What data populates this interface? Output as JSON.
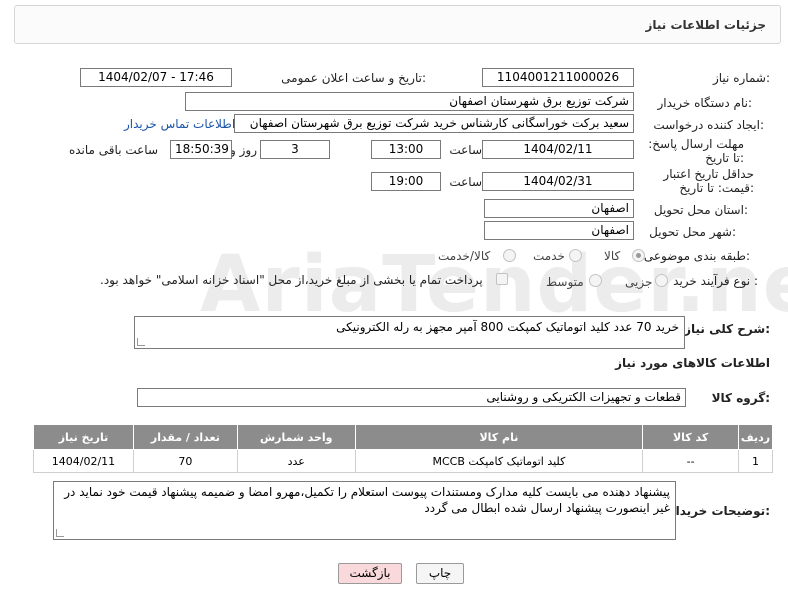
{
  "colors": {
    "accent_link": "#1a55a8",
    "header_bg": "#8c8c8c",
    "back_button_bg": "#f9d9dc"
  },
  "panel": {
    "title": "جزئیات اطلاعات نیاز"
  },
  "need_number": {
    "label": "شماره نیاز:",
    "value": "1104001211000026"
  },
  "announce": {
    "label": "تاریخ و ساعت اعلان عمومی:",
    "value": "1404/02/07 - 17:46"
  },
  "buyer": {
    "label": "نام دستگاه خریدار:",
    "value": "شرکت توزیع برق شهرستان اصفهان"
  },
  "creator": {
    "label": "ایجاد کننده درخواست:",
    "value": "سعید برکت خوراسگانی کارشناس خرید شرکت توزیع برق شهرستان اصفهان",
    "contact_link": "اطلاعات تماس خریدار"
  },
  "deadline": {
    "label": "مهلت ارسال پاسخ: تا تاریخ:",
    "date": "1404/02/11",
    "time_label": "ساعت",
    "time": "13:00",
    "days": "3",
    "days_label": "روز و",
    "remaining": "18:50:39",
    "remaining_label": "ساعت باقی مانده"
  },
  "min_validity": {
    "label": "حداقل تاریخ اعتبار قیمت: تا تاریخ:",
    "date": "1404/02/31",
    "time_label": "ساعت",
    "time": "19:00"
  },
  "province": {
    "label": "استان محل تحویل:",
    "value": "اصفهان"
  },
  "city": {
    "label": "شهر محل تحویل:",
    "value": "اصفهان"
  },
  "category": {
    "label": "طبقه بندی موضوعی:",
    "options": [
      "کالا",
      "خدمت",
      "کالا/خدمت"
    ],
    "selected": "کالا"
  },
  "process": {
    "label": "نوع فرآیند خرید :",
    "options": [
      "جزیی",
      "متوسط"
    ],
    "selected": "",
    "payment_note": "پرداخت تمام یا بخشی از مبلغ خرید،از محل \"اسناد خزانه اسلامی\" خواهد بود."
  },
  "description": {
    "label": "شرح کلی نیاز:",
    "value": "خرید 70 عدد کلید اتوماتیک کمپکت 800 آمپر مجهز به رله الکترونیکی"
  },
  "goods_info": {
    "title": "اطلاعات کالاهای مورد نیاز"
  },
  "goods_group": {
    "label": "گروه کالا:",
    "value": "قطعات و تجهیزات الکتریکی و روشنایی"
  },
  "table": {
    "headers": [
      "ردیف",
      "کد کالا",
      "نام کالا",
      "واحد شمارش",
      "تعداد / مقدار",
      "تاریخ نیاز"
    ],
    "rows": [
      {
        "row": "1",
        "code": "--",
        "name": "کلید اتوماتیک کامپکت MCCB",
        "unit": "عدد",
        "qty": "70",
        "date": "1404/02/11"
      }
    ]
  },
  "buyer_notes": {
    "label": "توضیحات خریدار:",
    "value": "پیشنهاد دهنده می بایست کلیه مدارک ومستندات پیوست استعلام را تکمیل،مهرو امضا و ضمیمه پیشنهاد قیمت خود نماید در غیر اینصورت پیشنهاد ارسال شده ابطال می گردد"
  },
  "buttons": {
    "print": "چاپ",
    "back": "بازگشت"
  },
  "watermark": "AriaTender.net"
}
